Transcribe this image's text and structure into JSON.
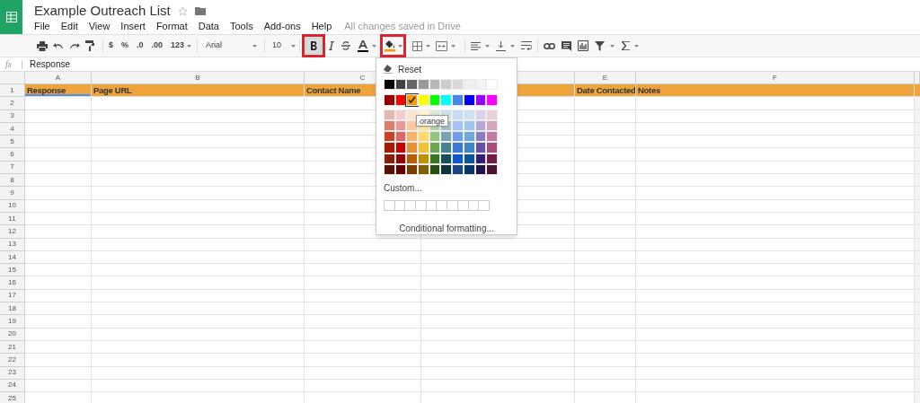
{
  "document": {
    "title": "Example Outreach List",
    "starred": false,
    "save_status": "All changes saved in Drive"
  },
  "menu": [
    "File",
    "Edit",
    "View",
    "Insert",
    "Format",
    "Data",
    "Tools",
    "Add-ons",
    "Help"
  ],
  "toolbar": {
    "number_formats": [
      "$",
      "%",
      ".0",
      ".00",
      "123"
    ],
    "font": "Arial",
    "font_size": "10",
    "bold_active": true,
    "bold_highlighted": true,
    "fill_highlighted": true,
    "fill_menu_open": true
  },
  "formula_bar": {
    "label": "fx",
    "value": "Response"
  },
  "columns": [
    {
      "letter": "A",
      "heading": "Response",
      "selected": true
    },
    {
      "letter": "B",
      "heading": "Page URL",
      "selected": false
    },
    {
      "letter": "C",
      "heading": "Contact Name",
      "selected": false
    },
    {
      "selected": false
    },
    {
      "letter": "E",
      "heading": "Date Contacted",
      "selected": false
    },
    {
      "letter": "F",
      "heading": "Notes",
      "selected": false
    }
  ],
  "row_numbers": [
    "1",
    "2",
    "3",
    "4",
    "5",
    "6",
    "7",
    "8",
    "9",
    "10",
    "11",
    "12",
    "13",
    "14",
    "15",
    "16",
    "17",
    "18",
    "19",
    "20",
    "21",
    "22",
    "23",
    "24",
    "25"
  ],
  "fill_menu": {
    "reset": "Reset",
    "custom": "Custom...",
    "conditional": "Conditional formatting...",
    "tooltip": "orange",
    "palette": [
      [
        {
          "color": "#000000",
          "selected": false
        },
        {
          "color": "#434343",
          "selected": false
        },
        {
          "color": "#666666",
          "selected": false
        },
        {
          "color": "#999999",
          "selected": false
        },
        {
          "color": "#b7b7b7",
          "selected": false
        },
        {
          "color": "#cccccc",
          "selected": false
        },
        {
          "color": "#d9d9d9",
          "selected": false
        },
        {
          "color": "#efefef",
          "selected": false
        },
        {
          "color": "#f3f3f3",
          "selected": false
        },
        {
          "color": "#ffffff",
          "selected": false
        }
      ],
      [
        {
          "color": "#980000",
          "selected": false
        },
        {
          "color": "#ff0000",
          "selected": false
        },
        {
          "color": "#ff9900",
          "selected": true
        },
        {
          "color": "#ffff00",
          "selected": false
        },
        {
          "color": "#00ff00",
          "selected": false
        },
        {
          "color": "#00ffff",
          "selected": false
        },
        {
          "color": "#4a86e8",
          "selected": false
        },
        {
          "color": "#0000ff",
          "selected": false
        },
        {
          "color": "#9900ff",
          "selected": false
        },
        {
          "color": "#ff00ff",
          "selected": false
        }
      ],
      [
        {
          "color": "#e6b8af",
          "selected": false
        },
        {
          "color": "#f4cccc",
          "selected": false
        },
        {
          "color": "#fce5cd",
          "selected": false
        },
        {
          "color": "#fff2cc",
          "selected": false
        },
        {
          "color": "#d9ead3",
          "selected": false
        },
        {
          "color": "#d0e0e3",
          "selected": false
        },
        {
          "color": "#c9daf8",
          "selected": false
        },
        {
          "color": "#cfe2f3",
          "selected": false
        },
        {
          "color": "#d9d2e9",
          "selected": false
        },
        {
          "color": "#ead1dc",
          "selected": false
        }
      ],
      [
        {
          "color": "#dd7e6b",
          "selected": false
        },
        {
          "color": "#ea9999",
          "selected": false
        },
        {
          "color": "#f9cb9c",
          "selected": false
        },
        {
          "color": "#ffe599",
          "selected": false
        },
        {
          "color": "#b6d7a8",
          "selected": false
        },
        {
          "color": "#a2c4c9",
          "selected": false
        },
        {
          "color": "#a4c2f4",
          "selected": false
        },
        {
          "color": "#9fc5e8",
          "selected": false
        },
        {
          "color": "#b4a7d6",
          "selected": false
        },
        {
          "color": "#d5a6bd",
          "selected": false
        }
      ],
      [
        {
          "color": "#cc4125",
          "selected": false
        },
        {
          "color": "#e06666",
          "selected": false
        },
        {
          "color": "#f6b26b",
          "selected": false
        },
        {
          "color": "#ffd966",
          "selected": false
        },
        {
          "color": "#93c47d",
          "selected": false
        },
        {
          "color": "#76a5af",
          "selected": false
        },
        {
          "color": "#6d9eeb",
          "selected": false
        },
        {
          "color": "#6fa8dc",
          "selected": false
        },
        {
          "color": "#8e7cc3",
          "selected": false
        },
        {
          "color": "#c27ba0",
          "selected": false
        }
      ],
      [
        {
          "color": "#a61c00",
          "selected": false
        },
        {
          "color": "#cc0000",
          "selected": false
        },
        {
          "color": "#e69138",
          "selected": false
        },
        {
          "color": "#f1c232",
          "selected": false
        },
        {
          "color": "#6aa84f",
          "selected": false
        },
        {
          "color": "#45818e",
          "selected": false
        },
        {
          "color": "#3c78d8",
          "selected": false
        },
        {
          "color": "#3d85c6",
          "selected": false
        },
        {
          "color": "#674ea7",
          "selected": false
        },
        {
          "color": "#a64d79",
          "selected": false
        }
      ],
      [
        {
          "color": "#85200c",
          "selected": false
        },
        {
          "color": "#990000",
          "selected": false
        },
        {
          "color": "#b45f06",
          "selected": false
        },
        {
          "color": "#bf9000",
          "selected": false
        },
        {
          "color": "#38761d",
          "selected": false
        },
        {
          "color": "#134f5c",
          "selected": false
        },
        {
          "color": "#1155cc",
          "selected": false
        },
        {
          "color": "#0b5394",
          "selected": false
        },
        {
          "color": "#351c75",
          "selected": false
        },
        {
          "color": "#741b47",
          "selected": false
        }
      ],
      [
        {
          "color": "#5b0f00",
          "selected": false
        },
        {
          "color": "#660000",
          "selected": false
        },
        {
          "color": "#783f04",
          "selected": false
        },
        {
          "color": "#7f6000",
          "selected": false
        },
        {
          "color": "#274e13",
          "selected": false
        },
        {
          "color": "#0c343d",
          "selected": false
        },
        {
          "color": "#1c4587",
          "selected": false
        },
        {
          "color": "#073763",
          "selected": false
        },
        {
          "color": "#20124d",
          "selected": false
        },
        {
          "color": "#4c1130",
          "selected": false
        }
      ]
    ]
  }
}
